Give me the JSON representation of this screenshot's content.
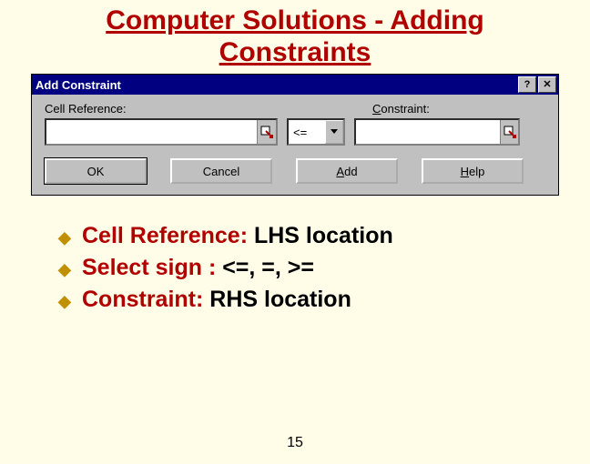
{
  "title_line1": "Computer Solutions - Adding",
  "title_line2": "Constraints",
  "dialog": {
    "title": "Add Constraint",
    "help_btn": "?",
    "close_btn": "✕",
    "label_cellref": "Cell Reference:",
    "label_constraint_u": "C",
    "label_constraint_rest": "onstraint:",
    "operator": "<=",
    "btn_ok": "OK",
    "btn_cancel": "Cancel",
    "btn_add_u": "A",
    "btn_add_rest": "dd",
    "btn_help_u": "H",
    "btn_help_rest": "elp"
  },
  "bullets": {
    "b1_term": "Cell Reference:",
    "b1_rest": " LHS location",
    "b2_term": "Select sign :",
    "b2_rest": " <=, =, >=",
    "b3_term": "Constraint:",
    "b3_rest": " RHS location"
  },
  "page_number": "15"
}
